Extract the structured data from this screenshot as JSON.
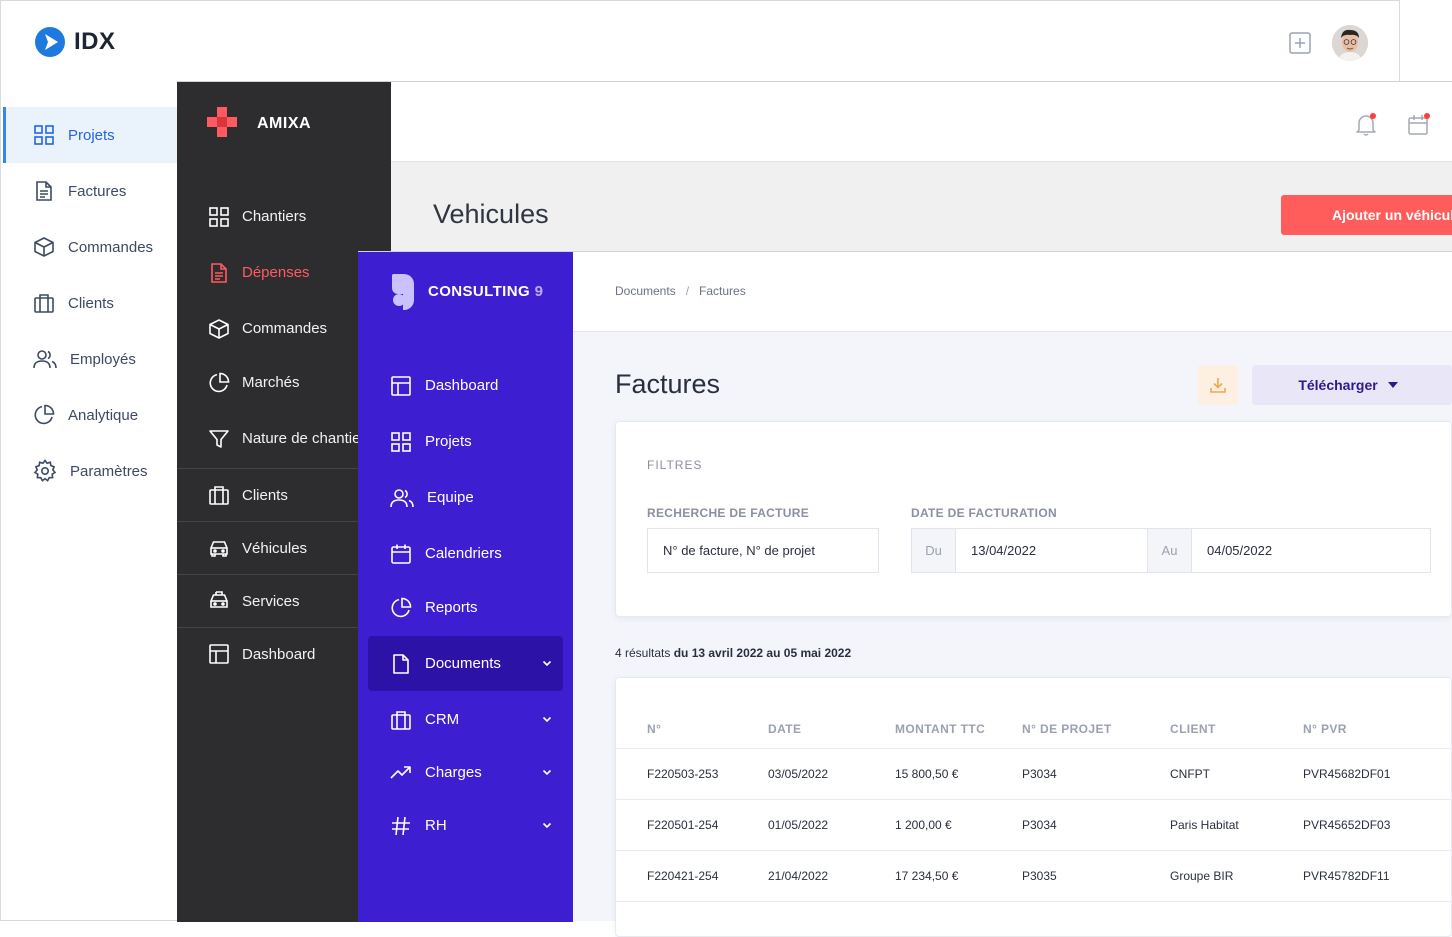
{
  "idx": {
    "brand": "IDX",
    "colors": {
      "accent": "#2563eb",
      "logo": "#1f7ae0"
    },
    "nav": [
      {
        "label": "Projets",
        "icon": "grid-icon",
        "active": true
      },
      {
        "label": "Factures",
        "icon": "document-icon"
      },
      {
        "label": "Commandes",
        "icon": "box-icon"
      },
      {
        "label": "Clients",
        "icon": "briefcase-icon"
      },
      {
        "label": "Employés",
        "icon": "users-icon"
      },
      {
        "label": "Analytique",
        "icon": "pie-chart-icon"
      },
      {
        "label": "Paramètres",
        "icon": "settings-icon"
      }
    ]
  },
  "amixa": {
    "brand": "AMIXA",
    "colors": {
      "accent": "#ff5c5c",
      "sidebar": "#2d2d2f"
    },
    "nav": [
      {
        "label": "Chantiers",
        "icon": "grid-icon"
      },
      {
        "label": "Dépenses",
        "icon": "document-icon",
        "active": true
      },
      {
        "label": "Commandes",
        "icon": "box-icon"
      },
      {
        "label": "Marchés",
        "icon": "pie-chart-icon"
      },
      {
        "label": "Nature de chantiers",
        "icon": "filter-icon"
      },
      {
        "label": "Clients",
        "icon": "briefcase-icon"
      },
      {
        "label": "Véhicules",
        "icon": "car-icon"
      },
      {
        "label": "Services",
        "icon": "taxi-icon"
      },
      {
        "label": "Dashboard",
        "icon": "layout-icon"
      }
    ],
    "page_title": "Vehicules",
    "add_button": "Ajouter un véhicule"
  },
  "consulting": {
    "brand": "CONSULTING",
    "brand_num": "9",
    "colors": {
      "sidebar": "#3d1fd1",
      "active": "#2d12a8",
      "download": "#f5a54a"
    },
    "nav": [
      {
        "label": "Dashboard",
        "icon": "layout-icon"
      },
      {
        "label": "Projets",
        "icon": "grid-icon"
      },
      {
        "label": "Equipe",
        "icon": "users-icon"
      },
      {
        "label": "Calendriers",
        "icon": "calendar-icon"
      },
      {
        "label": "Reports",
        "icon": "pie-chart-icon"
      },
      {
        "label": "Documents",
        "icon": "file-icon",
        "active": true,
        "chevron": true
      },
      {
        "label": "CRM",
        "icon": "briefcase-icon",
        "chevron": true
      },
      {
        "label": "Charges",
        "icon": "trending-icon",
        "chevron": true
      },
      {
        "label": "RH",
        "icon": "hash-icon",
        "chevron": true
      }
    ],
    "breadcrumb": [
      "Documents",
      "Factures"
    ],
    "page_title": "Factures",
    "download_button": "Télécharger",
    "filters": {
      "title": "FILTRES",
      "search_label": "RECHERCHE DE FACTURE",
      "search_value": "N° de facture, N° de projet",
      "date_label": "DATE DE FACTURATION",
      "from_prefix": "Du",
      "from_value": "13/04/2022",
      "to_prefix": "Au",
      "to_value": "04/05/2022"
    },
    "results_count": "4 résultats",
    "results_range": "du 13 avril 2022 au 05 mai 2022",
    "table": {
      "columns": [
        "N°",
        "DATE",
        "MONTANT TTC",
        "N° DE PROJET",
        "CLIENT",
        "N° PVR"
      ],
      "rows": [
        [
          "F220503-253",
          "03/05/2022",
          "15 800,50 €",
          "P3034",
          "CNFPT",
          "PVR45682DF01"
        ],
        [
          "F220501-254",
          "01/05/2022",
          "1 200,00 €",
          "P3034",
          "Paris Habitat",
          "PVR45652DF03"
        ],
        [
          "F220421-254",
          "21/04/2022",
          "17 234,50 €",
          "P3035",
          "Groupe BIR",
          "PVR45782DF11"
        ]
      ]
    }
  }
}
